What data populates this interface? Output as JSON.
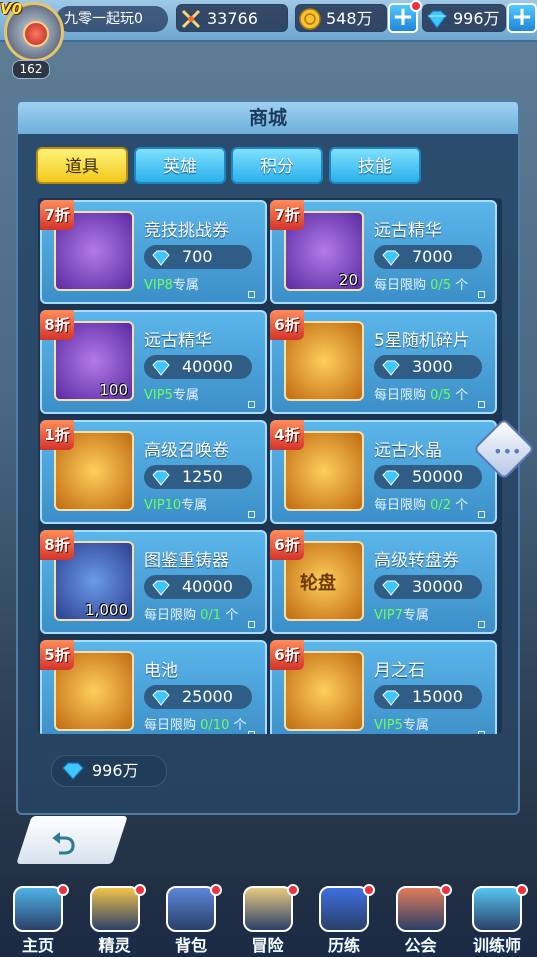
{
  "player": {
    "vip_tag": "V0",
    "level": "162",
    "name": "九零一起玩0"
  },
  "resources": {
    "power": "33766",
    "gold": "548万",
    "gems": "996万"
  },
  "shop": {
    "title": "商城",
    "tabs": [
      {
        "label": "道具",
        "active": true
      },
      {
        "label": "英雄",
        "active": false
      },
      {
        "label": "积分",
        "active": false
      },
      {
        "label": "技能",
        "active": false
      }
    ],
    "items": [
      {
        "discount": "7折",
        "name": "竞技挑战券",
        "price": "700",
        "qty": "",
        "limit_prefix": "",
        "limit_green": "VIP8",
        "limit_suffix": "专属",
        "icon": "ticket-icon",
        "tone": "purple"
      },
      {
        "discount": "7折",
        "name": "远古精华",
        "price": "7000",
        "qty": "20",
        "limit_prefix": "每日限购 ",
        "limit_green": "0/5",
        "limit_suffix": " 个",
        "icon": "essence-orb-icon",
        "tone": "purple"
      },
      {
        "discount": "8折",
        "name": "远古精华",
        "price": "40000",
        "qty": "100",
        "limit_prefix": "",
        "limit_green": "VIP5",
        "limit_suffix": "专属",
        "icon": "essence-orb-icon",
        "tone": "purple"
      },
      {
        "discount": "6折",
        "name": "5星随机碎片",
        "price": "3000",
        "qty": "",
        "limit_prefix": "每日限购 ",
        "limit_green": "0/5",
        "limit_suffix": " 个",
        "icon": "mystery-fragment-icon",
        "tone": "gold"
      },
      {
        "discount": "1折",
        "name": "高级召唤卷",
        "price": "1250",
        "qty": "",
        "limit_prefix": "",
        "limit_green": "VIP10",
        "limit_suffix": "专属",
        "icon": "summon-scroll-icon",
        "tone": "gold"
      },
      {
        "discount": "4折",
        "name": "远古水晶",
        "price": "50000",
        "qty": "",
        "limit_prefix": "每日限购 ",
        "limit_green": "0/2",
        "limit_suffix": " 个",
        "icon": "crystal-icon",
        "tone": "gold"
      },
      {
        "discount": "8折",
        "name": "图鉴重铸器",
        "price": "40000",
        "qty": "1,000",
        "limit_prefix": "每日限购 ",
        "limit_green": "0/1",
        "limit_suffix": " 个",
        "icon": "reforger-icon",
        "tone": "blue"
      },
      {
        "discount": "6折",
        "name": "高级转盘券",
        "price": "30000",
        "qty": "",
        "limit_prefix": "",
        "limit_green": "VIP7",
        "limit_suffix": "专属",
        "icon": "wheel-ticket-icon",
        "tone": "gold",
        "icon_text": "轮盘"
      },
      {
        "discount": "5折",
        "name": "电池",
        "price": "25000",
        "qty": "",
        "limit_prefix": "每日限购 ",
        "limit_green": "0/10",
        "limit_suffix": " 个",
        "icon": "battery-icon",
        "tone": "gold"
      },
      {
        "discount": "6折",
        "name": "月之石",
        "price": "15000",
        "qty": "",
        "limit_prefix": "",
        "limit_green": "VIP5",
        "limit_suffix": "专属",
        "icon": "moonstone-icon",
        "tone": "gold"
      }
    ],
    "balance": "996万"
  },
  "nav": [
    {
      "label": "主页",
      "icon": "home-icon",
      "color": "#4fb3e8",
      "dot": true
    },
    {
      "label": "精灵",
      "icon": "pokemon-icon",
      "color": "#f2c44a",
      "dot": true
    },
    {
      "label": "背包",
      "icon": "backpack-icon",
      "color": "#5d86d8",
      "dot": true
    },
    {
      "label": "冒险",
      "icon": "adventure-map-icon",
      "color": "#e7c980",
      "dot": true
    },
    {
      "label": "历练",
      "icon": "training-portal-icon",
      "color": "#3f6fe0",
      "dot": true
    },
    {
      "label": "公会",
      "icon": "guild-castle-icon",
      "color": "#e07b5a",
      "dot": true
    },
    {
      "label": "训练师",
      "icon": "trainer-icon",
      "color": "#56c6f0",
      "dot": true
    }
  ],
  "colors": {
    "accent_tab": "#f2c91c",
    "card_blue": "#4aa2d8",
    "limit_green": "#6cff5c",
    "badge_red": "#d4342b"
  }
}
